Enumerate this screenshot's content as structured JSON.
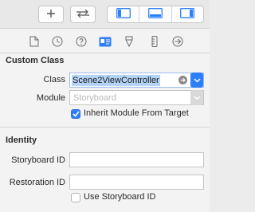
{
  "toolbar": {
    "add_icon": "plus-icon",
    "swap_icon": "swap-arrows-icon",
    "layout_icons": [
      "navigator-panel-icon",
      "debug-panel-icon",
      "inspector-panel-icon"
    ],
    "accent": "#2d7ff9"
  },
  "inspector_tabs": [
    "file-inspector-icon",
    "history-inspector-icon",
    "quick-help-icon",
    "identity-inspector-icon",
    "attributes-inspector-icon",
    "size-inspector-icon",
    "connections-inspector-icon"
  ],
  "custom_class": {
    "title": "Custom Class",
    "class_label": "Class",
    "class_value": "Scene2ViewController",
    "module_label": "Module",
    "module_placeholder": "Storyboard",
    "inherit_label": "Inherit Module From Target",
    "inherit_checked": true
  },
  "identity": {
    "title": "Identity",
    "storyboard_id_label": "Storyboard ID",
    "storyboard_id_value": "",
    "restoration_id_label": "Restoration ID",
    "restoration_id_value": "",
    "use_storyboard_id_label": "Use Storyboard ID",
    "use_storyboard_id_checked": false
  }
}
